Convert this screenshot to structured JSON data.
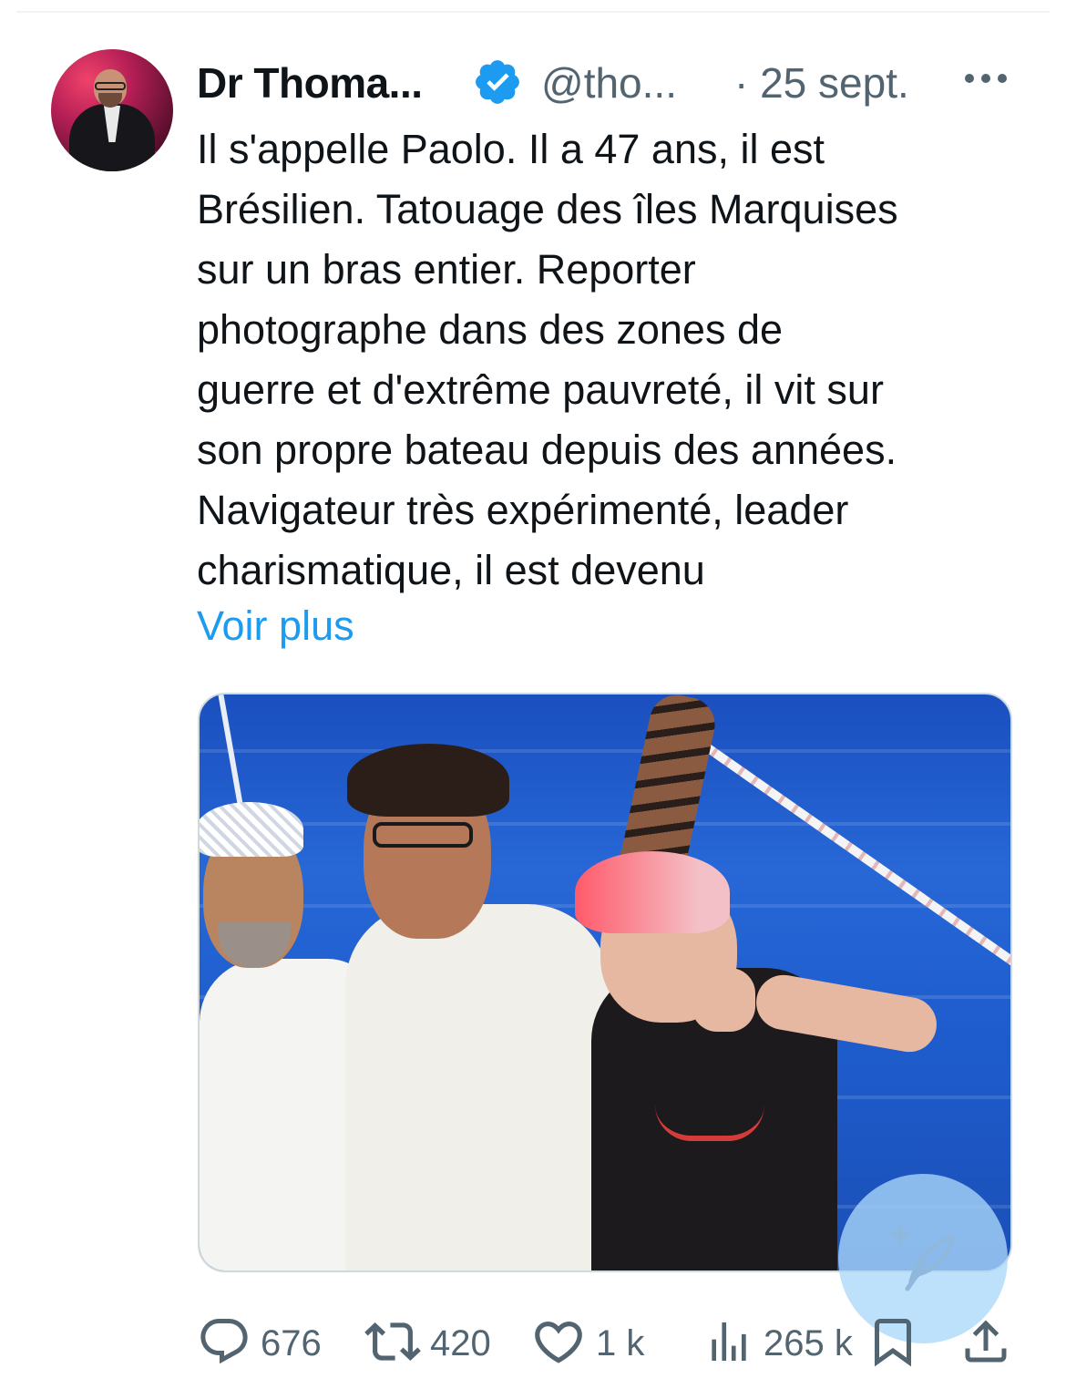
{
  "tweet": {
    "author_name": "Dr Thoma...",
    "handle": "@tho...",
    "date": "· 25 sept.",
    "text": "Il s'appelle Paolo. Il a 47 ans, il est\nBrésilien. Tatouage des îles Marquises\nsur un bras entier. Reporter\nphotographe dans des zones de\nguerre et d'extrême pauvreté, il vit sur\nson propre bateau depuis des années.\nNavigateur très expérimenté, leader\ncharismatique, il est devenu",
    "see_more": "Voir plus"
  },
  "metrics": {
    "replies": "676",
    "retweets": "420",
    "likes": "1 k",
    "views": "265 k"
  },
  "icons": {
    "verified": "verified-badge-icon",
    "more": "more-dots-icon",
    "reply": "reply-bubble-icon",
    "retweet": "retweet-icon",
    "like": "heart-icon",
    "views": "views-bars-icon",
    "bookmark": "bookmark-icon",
    "share": "share-icon",
    "compose": "compose-feather-icon"
  },
  "colors": {
    "accent": "#1d9bf0",
    "text": "#0f1419",
    "secondary": "#536471"
  }
}
